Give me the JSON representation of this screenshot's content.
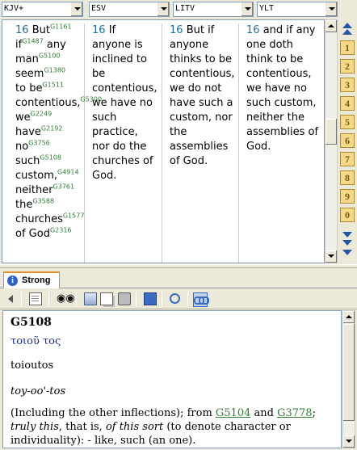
{
  "versions": {
    "v1": "KJV+",
    "v2": "ESV",
    "v3": "LITV",
    "v4": "YLT"
  },
  "verse_number": "16",
  "kjv": {
    "w1": "But",
    "s1": "G1161",
    "w2": "if",
    "s2": "G1487",
    "w3": "any",
    "w4": "man",
    "s4": "G5100",
    "w5": "seem",
    "s5": "G1380",
    "w6": "to",
    "w7": "be",
    "s7": "G1511",
    "w8": "contentious,",
    "s8": "G5300",
    "w9": "we",
    "s9": "G2249",
    "w10": "have",
    "s10": "G2192",
    "w11": "no",
    "s11": "G3756",
    "w12": "such",
    "s12": "G5108",
    "w13": "custom,",
    "s13": "G4914",
    "w14": "neither",
    "s14": "G3761",
    "w15": "the",
    "s15": "G3588",
    "w16": "churches",
    "s16": "G1577",
    "w17": "of",
    "w18": "God",
    "s18": "G2316"
  },
  "esv_text": "If anyone is inclined to be contentious, we have no such practice, nor do the churches of God.",
  "litv_text": "But if anyone thinks to be contentious, we do not have such a custom, nor the assemblies of God.",
  "ylt_text": "and if any one doth think to be contentious, we have no such custom, neither the assemblies of God.",
  "chapters": [
    "1",
    "2",
    "3",
    "4",
    "5",
    "6",
    "7",
    "8",
    "9",
    "0"
  ],
  "strong_tab": {
    "label": "Strong",
    "icon": "info-icon"
  },
  "strong_entry": {
    "number": "G5108",
    "greek": "τοιοῦ τος",
    "transliteration": "toioutos",
    "pronunciation": "toy-oo'-tos",
    "def_part1": "(Including the other inflections); from ",
    "link1": "G5104",
    "def_and": " and ",
    "link2": "G3778",
    "def_semi": ";",
    "def_italic1": "truly this",
    "def_mid": ", that is, ",
    "def_italic2": "of this sort",
    "def_part2": " (to denote character or individuality): - like, such (an one)."
  },
  "colors": {
    "verse_number": "#1f6fa0",
    "strongs_ref": "#2e7d32",
    "greek": "#1a2a9a",
    "tab_accent": "#e68b2c"
  }
}
